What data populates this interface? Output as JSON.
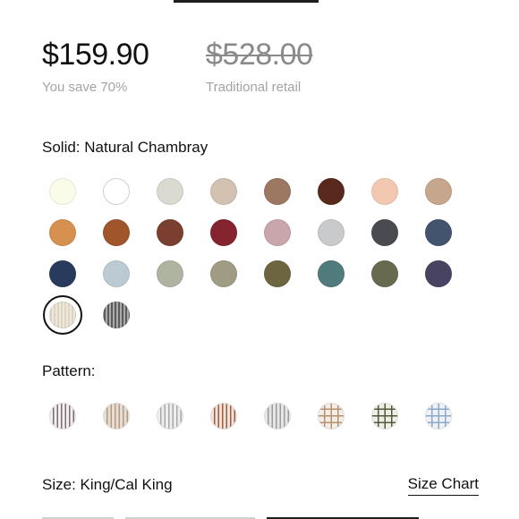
{
  "price": {
    "current": "$159.90",
    "retail": "$528.00",
    "savings": "You save 70%",
    "retail_label": "Traditional retail"
  },
  "solid": {
    "label": "Solid: Natural Chambray",
    "selected": "Natural Chambray",
    "swatches": [
      {
        "name": "ivory",
        "color": "#fbfbea"
      },
      {
        "name": "white",
        "color": "#ffffff"
      },
      {
        "name": "light-stone",
        "color": "#dadad0"
      },
      {
        "name": "sand",
        "color": "#d3c1b1"
      },
      {
        "name": "mocha",
        "color": "#9c7762"
      },
      {
        "name": "espresso",
        "color": "#58291c"
      },
      {
        "name": "peach",
        "color": "#f2c9b0"
      },
      {
        "name": "tan",
        "color": "#c6a68c"
      },
      {
        "name": "ochre",
        "color": "#d69150"
      },
      {
        "name": "rust",
        "color": "#a0552b"
      },
      {
        "name": "brick",
        "color": "#7b3f30"
      },
      {
        "name": "crimson",
        "color": "#85232e"
      },
      {
        "name": "rose",
        "color": "#c9a6ab"
      },
      {
        "name": "silver",
        "color": "#c8cacb"
      },
      {
        "name": "charcoal",
        "color": "#4a4b50"
      },
      {
        "name": "slate-blue",
        "color": "#43556e"
      },
      {
        "name": "navy",
        "color": "#283b5c"
      },
      {
        "name": "powder-blue",
        "color": "#bccbd3"
      },
      {
        "name": "sage",
        "color": "#aeb49f"
      },
      {
        "name": "khaki-green",
        "color": "#a09c83"
      },
      {
        "name": "olive",
        "color": "#6c6540"
      },
      {
        "name": "teal",
        "color": "#4f7b7c"
      },
      {
        "name": "moss",
        "color": "#686a50"
      },
      {
        "name": "plum-gray",
        "color": "#484361"
      },
      {
        "name": "natural-chambray",
        "color": "#ddd4c4",
        "texture": "stripe"
      },
      {
        "name": "charcoal-stripe",
        "color": "#7d7d7d",
        "texture": "stripe-dark"
      }
    ]
  },
  "pattern": {
    "label": "Pattern:",
    "swatches": [
      {
        "name": "mauve-stripe",
        "bg": "#f2f0ee",
        "line": "#7e6a76",
        "type": "vstripe"
      },
      {
        "name": "sand-stripe",
        "bg": "#e7ddd2",
        "line": "#b39a84",
        "type": "vstripe"
      },
      {
        "name": "gray-stripe",
        "bg": "#eeeeee",
        "line": "#a8a8a8",
        "type": "vstripe"
      },
      {
        "name": "rust-stripe",
        "bg": "#efe4dc",
        "line": "#a05b3e",
        "type": "vstripe"
      },
      {
        "name": "silver-stripe",
        "bg": "#e6e6e6",
        "line": "#9a9a9a",
        "type": "vstripe"
      },
      {
        "name": "tan-plaid",
        "bg": "#f3ede6",
        "line": "#b59073",
        "type": "grid"
      },
      {
        "name": "olive-plaid",
        "bg": "#eeeee6",
        "line": "#4f5b3a",
        "type": "grid"
      },
      {
        "name": "blue-plaid",
        "bg": "#eef2f7",
        "line": "#8da7c8",
        "type": "grid"
      }
    ]
  },
  "size": {
    "label": "Size: King/Cal King",
    "chart_link": "Size Chart"
  }
}
